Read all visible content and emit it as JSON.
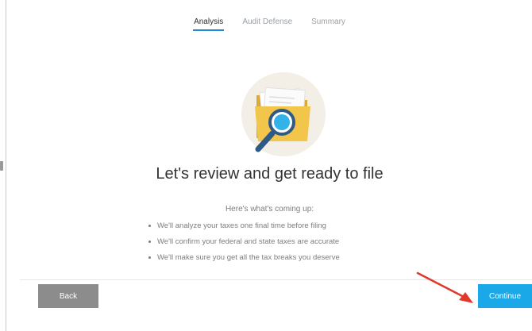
{
  "tabs": [
    {
      "label": "Analysis",
      "active": true
    },
    {
      "label": "Audit Defense",
      "active": false
    },
    {
      "label": "Summary",
      "active": false
    }
  ],
  "hero": {
    "icon": "folder-magnifier-icon"
  },
  "headline": "Let's review and get ready to file",
  "coming_up": {
    "intro": "Here's what's coming up:",
    "items": [
      "We'll analyze your taxes one final time before filing",
      "We'll confirm your federal and state taxes are accurate",
      "We'll make sure you get all the tax breaks you deserve"
    ]
  },
  "footer": {
    "back_label": "Back",
    "continue_label": "Continue"
  },
  "colors": {
    "accent": "#1aa8e8",
    "tab_underline": "#1f8bd6",
    "back_button": "#8c8c8c",
    "annotation_arrow": "#e0392b"
  }
}
